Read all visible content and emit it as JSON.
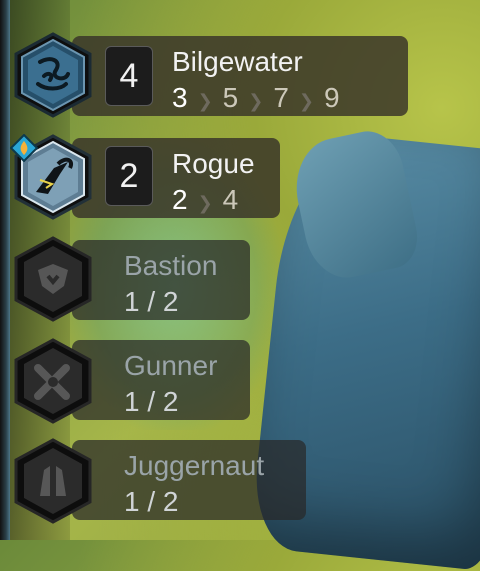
{
  "traits": [
    {
      "name": "Bilgewater",
      "count": "4",
      "tiers": [
        "3",
        "5",
        "7",
        "9"
      ],
      "icon": "bilgewater-icon",
      "state": "active"
    },
    {
      "name": "Rogue",
      "count": "2",
      "tiers": [
        "2",
        "4"
      ],
      "icon": "rogue-icon",
      "state": "active-bronze"
    },
    {
      "name": "Bastion",
      "progress": "1 / 2",
      "icon": "bastion-icon",
      "state": "inactive"
    },
    {
      "name": "Gunner",
      "progress": "1 / 2",
      "icon": "gunner-icon",
      "state": "inactive"
    },
    {
      "name": "Juggernaut",
      "progress": "1 / 2",
      "icon": "juggernaut-icon",
      "state": "inactive"
    }
  ],
  "colors": {
    "active_hex": "#2f5f7a",
    "bronze_hex": "#8aa7bd",
    "inactive_hex": "#2b2b2b",
    "gem": "#2aa6d6",
    "gem_core": "#f6b23b"
  }
}
